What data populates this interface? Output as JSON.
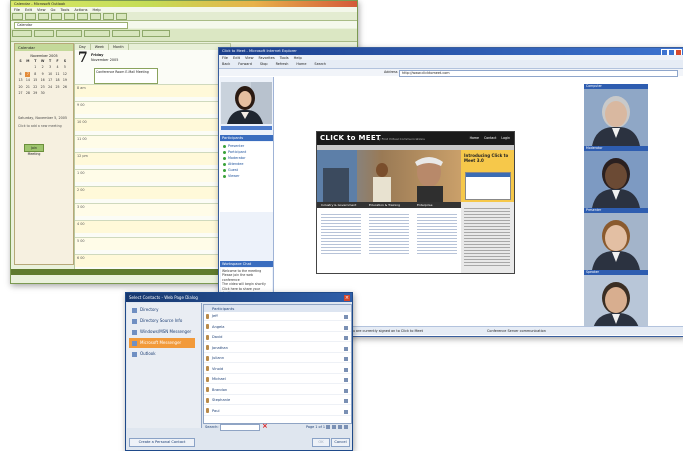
{
  "outlook": {
    "title": "Calendar - Microsoft Outlook",
    "menu": [
      "File",
      "Edit",
      "View",
      "Go",
      "Tools",
      "Actions",
      "Help"
    ],
    "address_value": "Calendar",
    "nav_title": "Calendar",
    "mini_month": "November 2005",
    "weekdays": [
      "S",
      "M",
      "T",
      "W",
      "T",
      "F",
      "S"
    ],
    "view_tabs": [
      "Day",
      "Week",
      "Month"
    ],
    "day_number": "7",
    "day_weekday": "Friday",
    "day_date": "November 2005",
    "appointment": "Conference Room E-Mail Meeting",
    "hours": [
      "8 am",
      "9 00",
      "10 00",
      "11 00",
      "12 pm",
      "1 00",
      "2 00",
      "3 00",
      "4 00",
      "5 00",
      "6 00"
    ],
    "side_text": "Click to add a new meeting",
    "side_button": "Join Meeting",
    "selected_date": "Saturday, November 5, 2005"
  },
  "clickmeet": {
    "title": "Click to Meet - Microsoft Internet Explorer",
    "menu": [
      "File",
      "Edit",
      "View",
      "Favorites",
      "Tools",
      "Help"
    ],
    "toolbar": [
      "Back",
      "Forward",
      "Stop",
      "Refresh",
      "Home",
      "Search"
    ],
    "address_label": "Address",
    "address_value": "http://www.clicktomeet.com",
    "participants_title": "Participants",
    "participants": [
      "Presenter",
      "Participant",
      "Moderator",
      "Attendee",
      "Guest",
      "Viewer"
    ],
    "chat_title": "Workspace Chat",
    "chat_lines": [
      "Welcome to the meeting",
      "Please join the web conference",
      "The video will begin shortly",
      "Click here to share your desktop"
    ],
    "site_logo": "CLICK to MEET",
    "site_tagline": "by First Virtual Communications",
    "site_nav": [
      "Home",
      "Contact",
      "Login"
    ],
    "hero_text": "Introducing Click to Meet 3.0",
    "columns": [
      "Industry & Government",
      "Education & Training",
      "Enterprise"
    ],
    "video_labels": [
      "Computer",
      "Moderator",
      "Presenter",
      "Speaker"
    ],
    "status_left": "You are currently signed on to Click to Meet",
    "status_right": "Conference Server communication"
  },
  "selectcontacts": {
    "title": "Select Contacts - Web Page Dialog",
    "sources": [
      "Directory",
      "Directory Source Info",
      "Windows/MSN Messenger",
      "Microsoft Messenger",
      "Outlook"
    ],
    "selected_source_index": 3,
    "list_header": "Participants",
    "contacts": [
      "Jeff",
      "Angela",
      "David",
      "Jonathan",
      "Juliann",
      "Vinoid",
      "Michael",
      "Brandon",
      "Stephanie",
      "Paul"
    ],
    "search_label": "Search:",
    "page_info": "Page 1 of 1",
    "create_button": "Create a Personal Contact",
    "ok_button": "OK",
    "cancel_button": "Cancel"
  }
}
